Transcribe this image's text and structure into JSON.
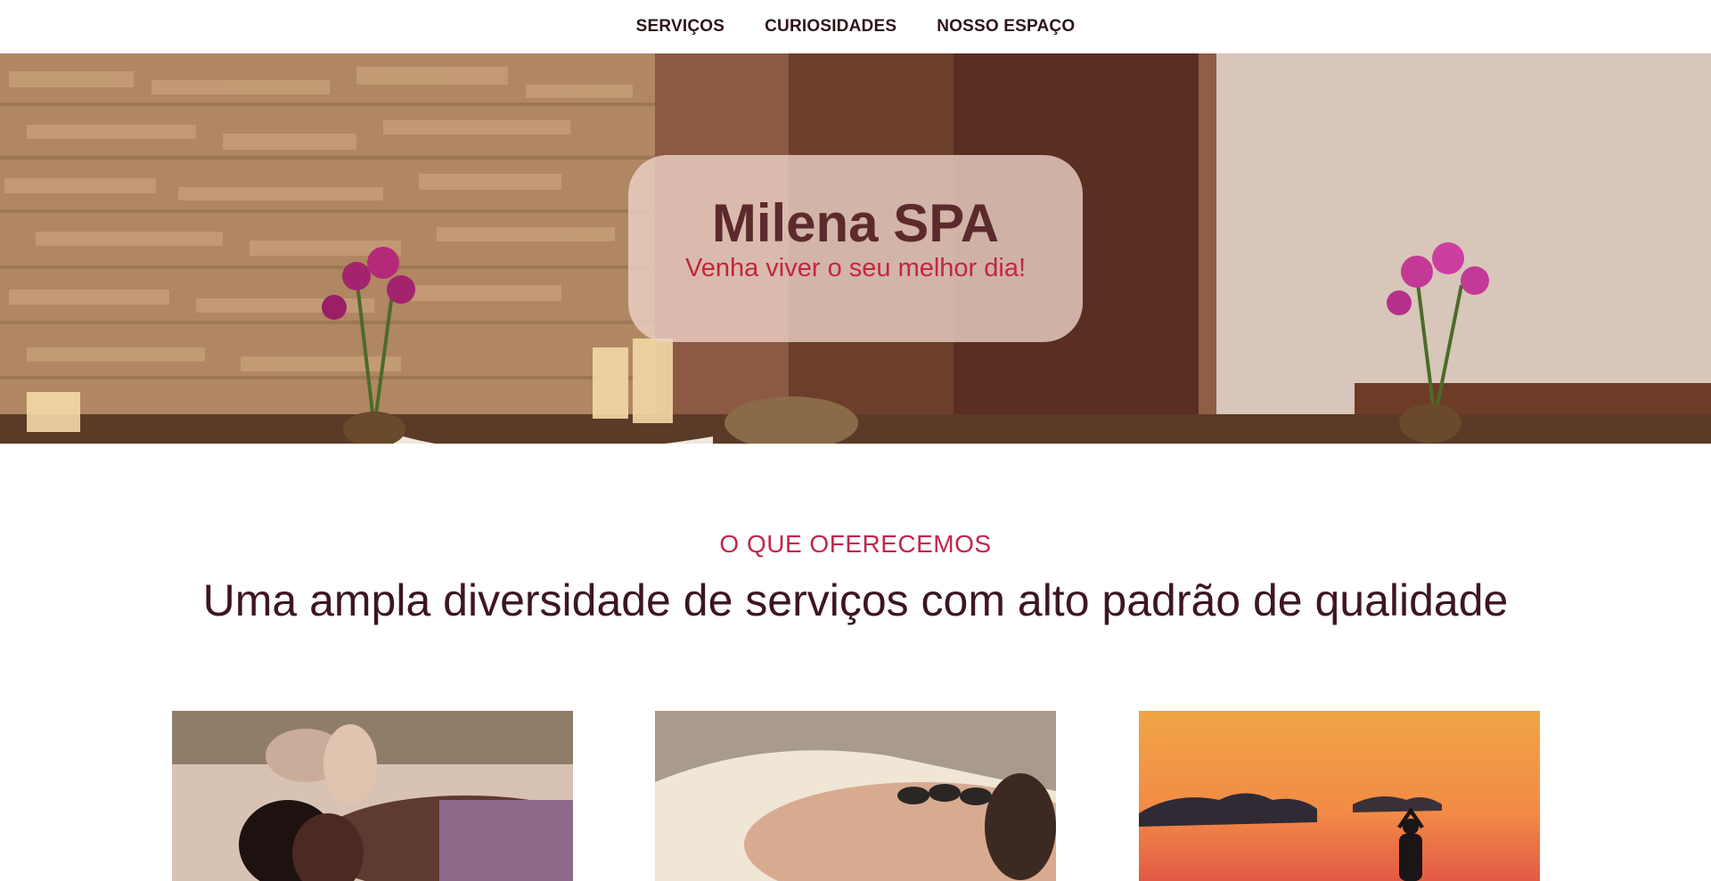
{
  "nav": {
    "items": [
      {
        "label": "SERVIÇOS"
      },
      {
        "label": "CURIOSIDADES"
      },
      {
        "label": "NOSSO ESPAÇO"
      }
    ]
  },
  "hero": {
    "title": "Milena SPA",
    "subtitle": "Venha viver o seu melhor dia!"
  },
  "services": {
    "eyebrow": "O QUE OFERECEMOS",
    "title": "Uma ampla diversidade de serviços com alto padrão de qualidade"
  },
  "colors": {
    "accent": "#c2264b",
    "title_text": "#3d1620",
    "hero_card": "#edd2c8"
  }
}
